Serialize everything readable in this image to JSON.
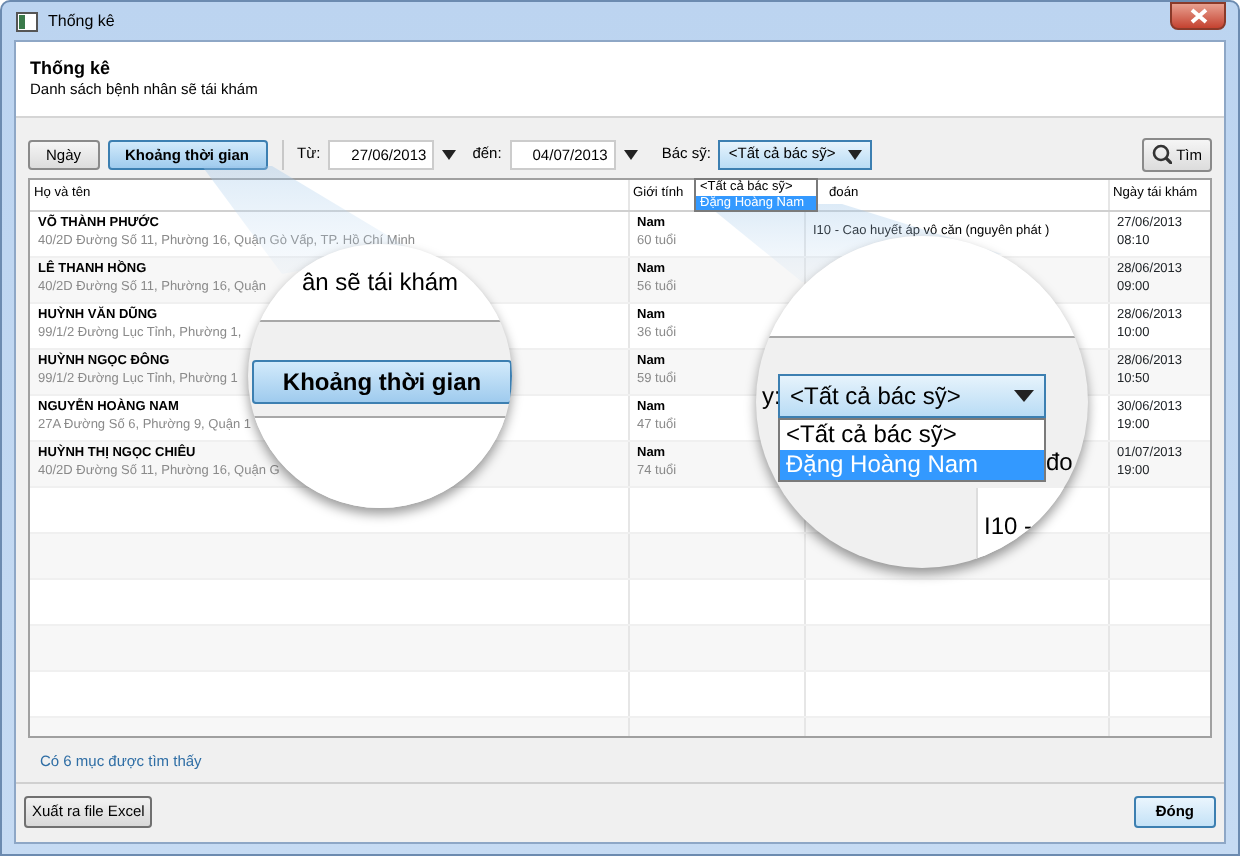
{
  "window": {
    "title": "Thống kê"
  },
  "header": {
    "title": "Thống kê",
    "subtitle": "Danh sách bệnh nhân sẽ tái khám"
  },
  "mode_buttons": [
    {
      "label": "Ngày",
      "selected": false
    },
    {
      "label": "Khoảng thời gian",
      "selected": true
    }
  ],
  "filters": {
    "from_label": "Từ:",
    "from_value": "27/06/2013",
    "to_label": "đến:",
    "to_value": "04/07/2013",
    "doctor_label": "Bác sỹ:",
    "doctor_value": "<Tất cả bác sỹ>"
  },
  "doctor_options": [
    {
      "label": "<Tất cả bác sỹ>",
      "selected": false
    },
    {
      "label": "Đặng Hoàng Nam",
      "selected": true
    }
  ],
  "search_button": "Tìm",
  "table": {
    "columns": [
      "Họ và tên",
      "Giới tính",
      "đoán",
      "Ngày tái khám"
    ],
    "rows": [
      {
        "name": "VÕ THÀNH PHƯỚC",
        "address": "40/2D Đường Số 11, Phường 16, Quận Gò Vấp, TP. Hồ Chí Minh",
        "gender": "Nam",
        "age": "60 tuổi",
        "diagnosis": "I10 - Cao huyết áp vô căn (nguyên phát )",
        "date": "27/06/2013",
        "time": "08:10"
      },
      {
        "name": "LÊ THANH HỒNG",
        "address": "40/2D Đường Số 11, Phường 16, Quận",
        "gender": "Nam",
        "age": "56 tuổi",
        "diagnosis": "",
        "date": "28/06/2013",
        "time": "09:00"
      },
      {
        "name": "HUỲNH VĂN DŨNG",
        "address": "99/1/2 Đường Lục Tỉnh, Phường 1,",
        "gender": "Nam",
        "age": "36 tuổi",
        "diagnosis": "",
        "date": "28/06/2013",
        "time": "10:00"
      },
      {
        "name": "HUỲNH NGỌC ĐÔNG",
        "address": "99/1/2 Đường Lục Tỉnh, Phường 1",
        "gender": "Nam",
        "age": "59 tuổi",
        "diagnosis": "",
        "date": "28/06/2013",
        "time": "10:50"
      },
      {
        "name": "NGUYỄN HOÀNG NAM",
        "address": "27A Đường Số 6, Phường 9, Quận 1",
        "gender": "Nam",
        "age": "47 tuổi",
        "diagnosis": "",
        "date": "30/06/2013",
        "time": "19:00"
      },
      {
        "name": "HUỲNH THỊ NGỌC CHIÊU",
        "address": "40/2D Đường Số 11, Phường 16, Quận G",
        "gender": "Nam",
        "age": "74 tuổi",
        "diagnosis": "",
        "date": "01/07/2013",
        "time": "19:00"
      }
    ]
  },
  "status": "Có 6 mục được tìm thấy",
  "footer": {
    "export_button": "Xuất ra file Excel",
    "close_button": "Đóng"
  },
  "magnifier_left": {
    "caption": "ân sẽ tái khám",
    "button": "Khoảng thời gian"
  },
  "magnifier_right": {
    "label": "y:",
    "select_value": "<Tất cả bác sỹ>",
    "options": [
      {
        "label": "<Tất cả bác sỹ>",
        "selected": false
      },
      {
        "label": "Đặng Hoàng Nam",
        "selected": true
      }
    ],
    "fragment_right": "đo",
    "fragment_bottom": "I10 -"
  }
}
